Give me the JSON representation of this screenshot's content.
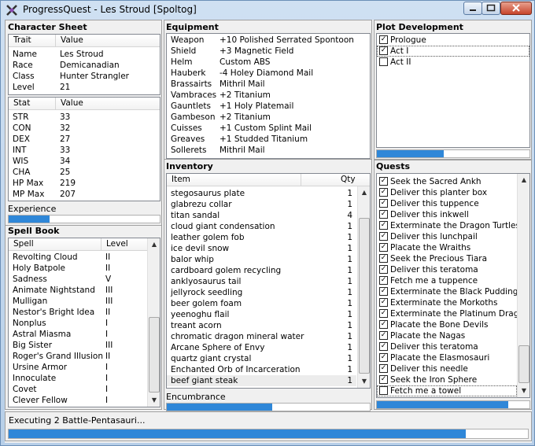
{
  "window": {
    "title": "ProgressQuest - Les Stroud [Spoltog]"
  },
  "character_sheet": {
    "title": "Character Sheet",
    "trait_header": "Trait",
    "value_header": "Value",
    "traits": [
      {
        "k": "Name",
        "v": "Les Stroud"
      },
      {
        "k": "Race",
        "v": "Demicanadian"
      },
      {
        "k": "Class",
        "v": "Hunter Strangler"
      },
      {
        "k": "Level",
        "v": "21"
      }
    ],
    "stat_header": "Stat",
    "stat_value_header": "Value",
    "stats": [
      {
        "k": "STR",
        "v": "33"
      },
      {
        "k": "CON",
        "v": "32"
      },
      {
        "k": "DEX",
        "v": "27"
      },
      {
        "k": "INT",
        "v": "33"
      },
      {
        "k": "WIS",
        "v": "34"
      },
      {
        "k": "CHA",
        "v": "25"
      },
      {
        "k": "HP Max",
        "v": "219"
      },
      {
        "k": "MP Max",
        "v": "207"
      }
    ],
    "experience_label": "Experience",
    "experience_progress": 0.27
  },
  "spell_book": {
    "title": "Spell Book",
    "spell_header": "Spell",
    "level_header": "Level",
    "spells": [
      {
        "k": "Revolting Cloud",
        "v": "II"
      },
      {
        "k": "Holy Batpole",
        "v": "II"
      },
      {
        "k": "Sadness",
        "v": "V"
      },
      {
        "k": "Animate Nightstand",
        "v": "III"
      },
      {
        "k": "Mulligan",
        "v": "III"
      },
      {
        "k": "Nestor's Bright Idea",
        "v": "II"
      },
      {
        "k": "Nonplus",
        "v": "I"
      },
      {
        "k": "Astral Miasma",
        "v": "I"
      },
      {
        "k": "Big Sister",
        "v": "III"
      },
      {
        "k": "Roger's Grand Illusion",
        "v": "II"
      },
      {
        "k": "Ursine Armor",
        "v": "I"
      },
      {
        "k": "Innoculate",
        "v": "I"
      },
      {
        "k": "Covet",
        "v": "I"
      },
      {
        "k": "Clever Fellow",
        "v": "I"
      }
    ]
  },
  "equipment": {
    "title": "Equipment",
    "items": [
      {
        "k": "Weapon",
        "v": "+10 Polished Serrated Spontoon"
      },
      {
        "k": "Shield",
        "v": "+3 Magnetic Field"
      },
      {
        "k": "Helm",
        "v": "Custom ABS"
      },
      {
        "k": "Hauberk",
        "v": "-4 Holey Diamond Mail"
      },
      {
        "k": "Brassairts",
        "v": "Mithril Mail"
      },
      {
        "k": "Vambraces",
        "v": "+2 Titanium"
      },
      {
        "k": "Gauntlets",
        "v": "+1 Holy Platemail"
      },
      {
        "k": "Gambeson",
        "v": "+2 Titanium"
      },
      {
        "k": "Cuisses",
        "v": "+1 Custom Splint Mail"
      },
      {
        "k": "Greaves",
        "v": "+1 Studded Titanium"
      },
      {
        "k": "Sollerets",
        "v": "Mithril Mail"
      }
    ]
  },
  "inventory": {
    "title": "Inventory",
    "item_header": "Item",
    "qty_header": "Qty",
    "items": [
      {
        "k": "stegosaurus plate",
        "v": "1"
      },
      {
        "k": "glabrezu collar",
        "v": "1"
      },
      {
        "k": "titan sandal",
        "v": "4"
      },
      {
        "k": "cloud giant condensation",
        "v": "1"
      },
      {
        "k": "leather golem fob",
        "v": "1"
      },
      {
        "k": "ice devil snow",
        "v": "1"
      },
      {
        "k": "balor whip",
        "v": "1"
      },
      {
        "k": "cardboard golem recycling",
        "v": "1"
      },
      {
        "k": "anklyosaurus tail",
        "v": "1"
      },
      {
        "k": "jellyrock seedling",
        "v": "1"
      },
      {
        "k": "beer golem foam",
        "v": "1"
      },
      {
        "k": "yeenoghu flail",
        "v": "1"
      },
      {
        "k": "treant acorn",
        "v": "1"
      },
      {
        "k": "chromatic dragon mineral water",
        "v": "1"
      },
      {
        "k": "Arcane Sphere of Envy",
        "v": "1"
      },
      {
        "k": "quartz giant crystal",
        "v": "1"
      },
      {
        "k": "Enchanted Orb of Incarceration",
        "v": "1"
      },
      {
        "k": "beef giant steak",
        "v": "1"
      }
    ],
    "encumbrance_label": "Encumbrance",
    "encumbrance_progress": 0.52
  },
  "plot": {
    "title": "Plot Development",
    "acts": [
      {
        "label": "Prologue",
        "checked": true
      },
      {
        "label": "Act I",
        "checked": true
      },
      {
        "label": "Act II",
        "checked": false
      }
    ],
    "progress": 0.44
  },
  "quests": {
    "title": "Quests",
    "items": [
      {
        "label": "Seek the Sacred Ankh",
        "checked": true
      },
      {
        "label": "Deliver this planter box",
        "checked": true
      },
      {
        "label": "Deliver this tuppence",
        "checked": true
      },
      {
        "label": "Deliver this inkwell",
        "checked": true
      },
      {
        "label": "Exterminate the Dragon Turtles",
        "checked": true
      },
      {
        "label": "Deliver this lunchpail",
        "checked": true
      },
      {
        "label": "Placate the Wraiths",
        "checked": true
      },
      {
        "label": "Seek the Precious Tiara",
        "checked": true
      },
      {
        "label": "Deliver this teratoma",
        "checked": true
      },
      {
        "label": "Fetch me a tuppence",
        "checked": true
      },
      {
        "label": "Exterminate the Black Puddings",
        "checked": true
      },
      {
        "label": "Exterminate the Morkoths",
        "checked": true
      },
      {
        "label": "Exterminate the Platinum Dragons",
        "checked": true
      },
      {
        "label": "Placate the Bone Devils",
        "checked": true
      },
      {
        "label": "Placate the Nagas",
        "checked": true
      },
      {
        "label": "Deliver this teratoma",
        "checked": true
      },
      {
        "label": "Placate the Elasmosauri",
        "checked": true
      },
      {
        "label": "Deliver this needle",
        "checked": true
      },
      {
        "label": "Seek the Iron Sphere",
        "checked": true
      },
      {
        "label": "Fetch me a towel",
        "checked": false
      }
    ],
    "progress": 0.86
  },
  "status": {
    "text": "Executing 2 Battle-Pentasauri...",
    "progress": 0.88
  }
}
